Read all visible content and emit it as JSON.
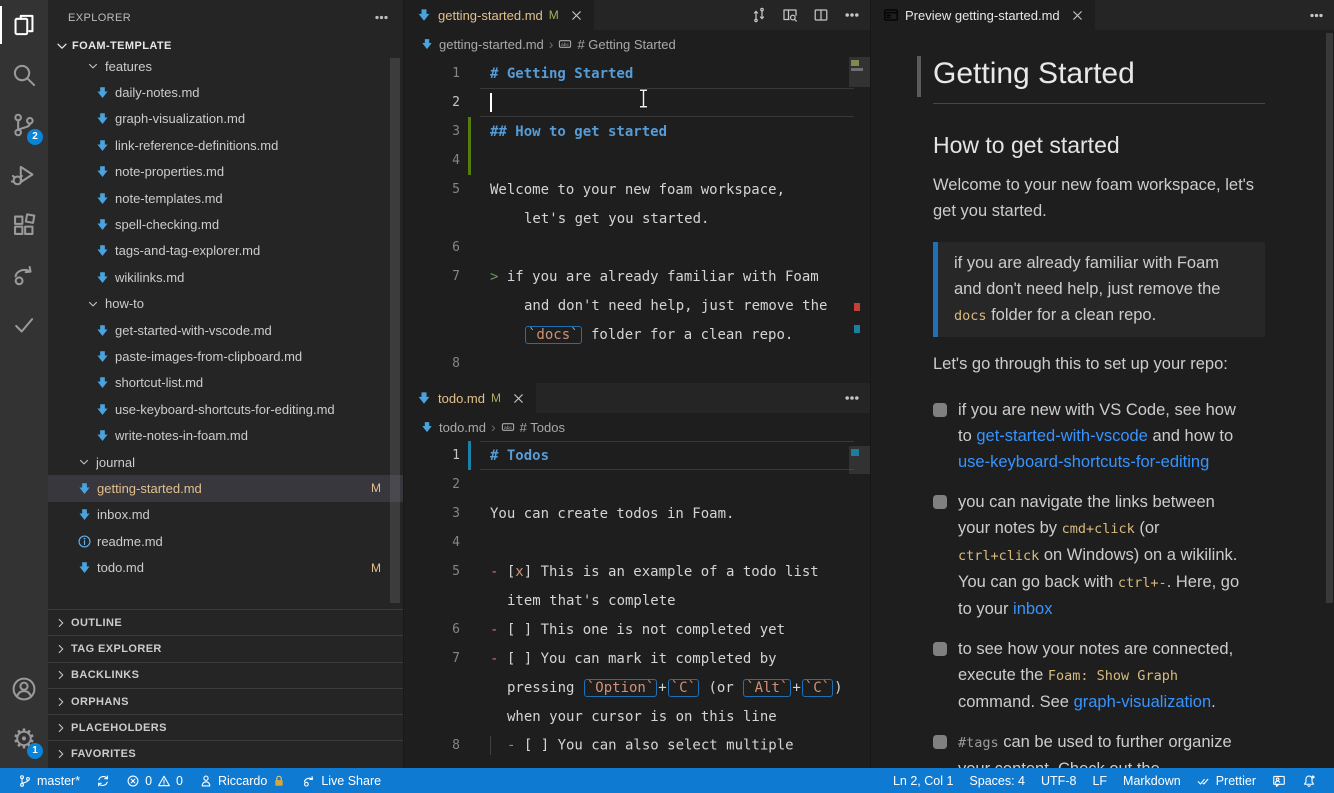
{
  "colors": {
    "status_bar": "#0f7ad2",
    "badge": "#0a84d8",
    "modified": "#e2c08d",
    "heading_blue": "#569cd6",
    "code_orange": "#ce9178",
    "preview_code": "#d7ba7d",
    "link": "#3794ff",
    "gutter_added": "#587c0c",
    "gutter_modified": "#1b81a8"
  },
  "activity_bar": {
    "top": [
      {
        "name": "explorer",
        "active": true
      },
      {
        "name": "search"
      },
      {
        "name": "source-control",
        "badge": "2"
      },
      {
        "name": "run-debug"
      },
      {
        "name": "extensions"
      },
      {
        "name": "live-share"
      },
      {
        "name": "tasks-check"
      }
    ],
    "bottom": [
      {
        "name": "account"
      },
      {
        "name": "settings",
        "badge": "1"
      }
    ]
  },
  "sidebar": {
    "title": "EXPLORER",
    "workspace": "FOAM-TEMPLATE",
    "tree": [
      {
        "label": "features",
        "kind": "folder",
        "level": 2
      },
      {
        "label": "daily-notes.md",
        "kind": "file",
        "icon": "foam",
        "level": 3
      },
      {
        "label": "graph-visualization.md",
        "kind": "file",
        "icon": "foam",
        "level": 3
      },
      {
        "label": "link-reference-definitions.md",
        "kind": "file",
        "icon": "foam",
        "level": 3
      },
      {
        "label": "note-properties.md",
        "kind": "file",
        "icon": "foam",
        "level": 3
      },
      {
        "label": "note-templates.md",
        "kind": "file",
        "icon": "foam",
        "level": 3
      },
      {
        "label": "spell-checking.md",
        "kind": "file",
        "icon": "foam",
        "level": 3
      },
      {
        "label": "tags-and-tag-explorer.md",
        "kind": "file",
        "icon": "foam",
        "level": 3
      },
      {
        "label": "wikilinks.md",
        "kind": "file",
        "icon": "foam",
        "level": 3
      },
      {
        "label": "how-to",
        "kind": "folder",
        "level": 2
      },
      {
        "label": "get-started-with-vscode.md",
        "kind": "file",
        "icon": "foam",
        "level": 3
      },
      {
        "label": "paste-images-from-clipboard.md",
        "kind": "file",
        "icon": "foam",
        "level": 3
      },
      {
        "label": "shortcut-list.md",
        "kind": "file",
        "icon": "foam",
        "level": 3
      },
      {
        "label": "use-keyboard-shortcuts-for-editing.md",
        "kind": "file",
        "icon": "foam",
        "level": 3
      },
      {
        "label": "write-notes-in-foam.md",
        "kind": "file",
        "icon": "foam",
        "level": 3
      },
      {
        "label": "journal",
        "kind": "folder",
        "level": 1
      },
      {
        "label": "getting-started.md",
        "kind": "file",
        "icon": "foam",
        "level": 1,
        "selected": true,
        "badge": "M"
      },
      {
        "label": "inbox.md",
        "kind": "file",
        "icon": "foam",
        "level": 1
      },
      {
        "label": "readme.md",
        "kind": "file",
        "icon": "info",
        "level": 1
      },
      {
        "label": "todo.md",
        "kind": "file",
        "icon": "foam",
        "level": 1,
        "badge": "M"
      }
    ],
    "sections": [
      "OUTLINE",
      "TAG EXPLORER",
      "BACKLINKS",
      "ORPHANS",
      "PLACEHOLDERS",
      "FAVORITES"
    ]
  },
  "editor1": {
    "tab": {
      "label": "getting-started.md",
      "badge": "M",
      "icon": "foam"
    },
    "actions": [
      "open-changes",
      "open-preview-side",
      "split-editor",
      "more"
    ],
    "breadcrumb": [
      {
        "icon": "foam",
        "label": "getting-started.md"
      },
      {
        "icon": "symbol-string",
        "label": "# Getting Started"
      }
    ],
    "rows": [
      {
        "n": "1",
        "seg": [
          {
            "t": "# Getting Started",
            "c": "head"
          }
        ]
      },
      {
        "n": "2",
        "cur": true,
        "cursor": true,
        "seg": []
      },
      {
        "n": "3",
        "g": "add",
        "seg": [
          {
            "t": "## How to get started",
            "c": "head"
          }
        ]
      },
      {
        "n": "4",
        "g": "add",
        "seg": []
      },
      {
        "n": "5",
        "seg": [
          {
            "t": "Welcome to your new foam workspace,",
            "c": "p"
          }
        ]
      },
      {
        "wrap": 34,
        "seg": [
          {
            "t": "let's get you started.",
            "c": "p"
          }
        ]
      },
      {
        "n": "6",
        "seg": []
      },
      {
        "n": "7",
        "seg": [
          {
            "t": "> ",
            "c": "quote"
          },
          {
            "t": "if you are already familiar with Foam",
            "c": "p"
          }
        ]
      },
      {
        "wrap": 34,
        "seg": [
          {
            "t": "and don't need help, just remove the",
            "c": "p"
          }
        ]
      },
      {
        "wrap": 34,
        "seg": [
          {
            "t": "`docs`",
            "c": "codebox"
          },
          {
            "t": " folder for a clean repo.",
            "c": "p"
          }
        ]
      },
      {
        "n": "8",
        "seg": []
      }
    ]
  },
  "editor2": {
    "tab": {
      "label": "todo.md",
      "badge": "M",
      "icon": "foam"
    },
    "actions": [
      "more"
    ],
    "breadcrumb": [
      {
        "icon": "foam",
        "label": "todo.md"
      },
      {
        "icon": "symbol-string",
        "label": "# Todos"
      }
    ],
    "rows": [
      {
        "n": "1",
        "cur": true,
        "g": "mod",
        "seg": [
          {
            "t": "# Todos",
            "c": "head"
          }
        ]
      },
      {
        "n": "2",
        "seg": []
      },
      {
        "n": "3",
        "seg": [
          {
            "t": "You can create todos in Foam.",
            "c": "p"
          }
        ]
      },
      {
        "n": "4",
        "seg": []
      },
      {
        "n": "5",
        "seg": [
          {
            "t": "- ",
            "c": "bullet"
          },
          {
            "t": "[",
            "c": "p"
          },
          {
            "t": "x",
            "c": "code"
          },
          {
            "t": "] This is an example of a todo list",
            "c": "p"
          }
        ]
      },
      {
        "wrap": 17,
        "seg": [
          {
            "t": "item that's complete",
            "c": "p"
          }
        ]
      },
      {
        "n": "6",
        "seg": [
          {
            "t": "- ",
            "c": "bullet"
          },
          {
            "t": "[ ] This one is not completed yet",
            "c": "p"
          }
        ]
      },
      {
        "n": "7",
        "seg": [
          {
            "t": "- ",
            "c": "bullet"
          },
          {
            "t": "[ ] You can mark it completed by",
            "c": "p"
          }
        ]
      },
      {
        "wrap": 17,
        "seg": [
          {
            "t": "pressing ",
            "c": "p"
          },
          {
            "t": "`Option`",
            "c": "codebox"
          },
          {
            "t": "+",
            "c": "p"
          },
          {
            "t": "`C`",
            "c": "codebox"
          },
          {
            "t": " (or ",
            "c": "p"
          },
          {
            "t": "`Alt`",
            "c": "codebox"
          },
          {
            "t": "+",
            "c": "p"
          },
          {
            "t": "`C`",
            "c": "codebox"
          },
          {
            "t": ")",
            "c": "p"
          }
        ]
      },
      {
        "wrap": 17,
        "seg": [
          {
            "t": "when your cursor is on this line",
            "c": "p"
          }
        ]
      },
      {
        "n": "8",
        "guide": true,
        "seg": [
          {
            "t": "- ",
            "c": "bullet"
          },
          {
            "t": "[ ] You can also select multiple",
            "c": "p"
          }
        ]
      }
    ]
  },
  "preview": {
    "tab": {
      "label": "Preview getting-started.md",
      "icon": "preview"
    },
    "blocks": [
      {
        "type": "h1",
        "runs": [
          {
            "t": "Getting Started"
          }
        ]
      },
      {
        "type": "h2",
        "runs": [
          {
            "t": "How to get started"
          }
        ]
      },
      {
        "type": "p",
        "runs": [
          {
            "t": "Welcome to your new foam workspace, let's get you started."
          }
        ]
      },
      {
        "type": "quote",
        "runs": [
          {
            "t": "if you are already familiar with Foam and don't need help, just remove the "
          },
          {
            "t": "docs",
            "k": "code"
          },
          {
            "t": " folder for a clean repo."
          }
        ]
      },
      {
        "type": "p",
        "runs": [
          {
            "t": "Let's go through this to set up your repo:"
          }
        ]
      },
      {
        "type": "task",
        "runs": [
          {
            "t": "if you are new with VS Code, see how to "
          },
          {
            "t": "get-started-with-vscode",
            "k": "link"
          },
          {
            "t": " and how to "
          },
          {
            "t": "use-keyboard-shortcuts-for-editing",
            "k": "link"
          }
        ]
      },
      {
        "type": "task",
        "runs": [
          {
            "t": "you can navigate the links between your notes by "
          },
          {
            "t": "cmd+click",
            "k": "code"
          },
          {
            "t": " (or "
          },
          {
            "t": "ctrl+click",
            "k": "code"
          },
          {
            "t": " on Windows) on a wikilink. You can go back with "
          },
          {
            "t": "ctrl+-",
            "k": "code"
          },
          {
            "t": ". Here, go to your "
          },
          {
            "t": "inbox",
            "k": "link"
          }
        ]
      },
      {
        "type": "task",
        "runs": [
          {
            "t": "to see how your notes are connected, execute the "
          },
          {
            "t": "Foam: Show Graph",
            "k": "code"
          },
          {
            "t": " command. See "
          },
          {
            "t": "graph-visualization",
            "k": "link"
          },
          {
            "t": "."
          }
        ]
      },
      {
        "type": "task",
        "runs": [
          {
            "t": "#tags",
            "k": "tag"
          },
          {
            "t": " can be used to further organize your content. Check out the"
          }
        ]
      }
    ]
  },
  "status_bar": {
    "left": [
      {
        "icon": "branch",
        "label": "master*"
      },
      {
        "icon": "sync"
      },
      {
        "icon": "error",
        "label": "0",
        "icon2": "warning",
        "label2": "0"
      },
      {
        "icon": "person",
        "label": "Riccardo",
        "trail_icon": "lock"
      },
      {
        "icon": "live-share",
        "label": "Live Share"
      }
    ],
    "right": [
      {
        "label": "Ln 2, Col 1"
      },
      {
        "label": "Spaces: 4"
      },
      {
        "label": "UTF-8"
      },
      {
        "label": "LF"
      },
      {
        "label": "Markdown"
      },
      {
        "icon": "double-check",
        "label": "Prettier"
      },
      {
        "icon": "feedback"
      },
      {
        "icon": "bell"
      }
    ]
  }
}
